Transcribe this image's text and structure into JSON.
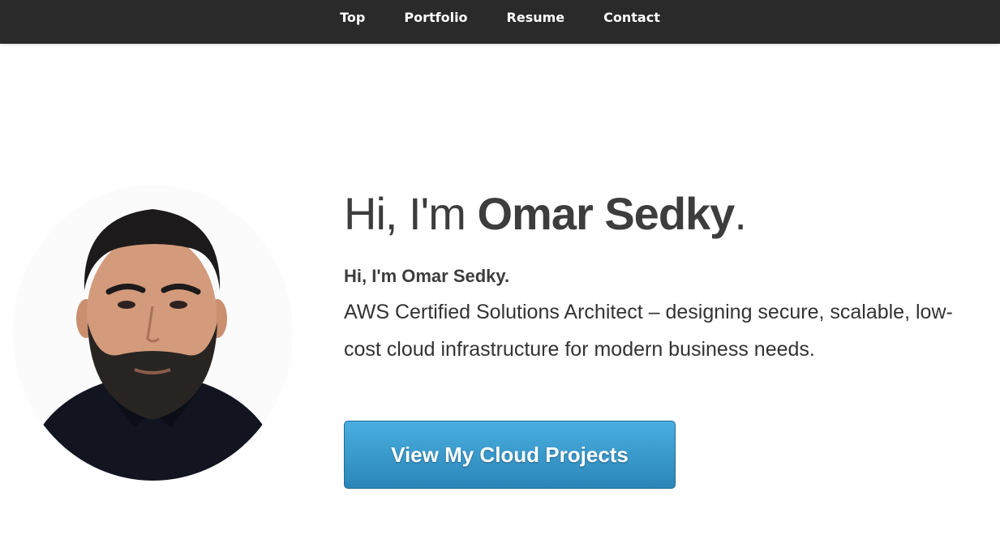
{
  "nav": {
    "items": [
      {
        "label": "Top"
      },
      {
        "label": "Portfolio"
      },
      {
        "label": "Resume"
      },
      {
        "label": "Contact"
      }
    ]
  },
  "hero": {
    "headline_prefix": "Hi, I'm ",
    "headline_name": "Omar Sedky",
    "headline_suffix": ".",
    "sub_title": "Hi, I'm Omar Sedky.",
    "tagline": "AWS Certified Solutions Architect – designing secure, scalable, low-cost cloud infrastructure for modern business needs.",
    "cta_label": "View My Cloud Projects"
  },
  "colors": {
    "nav_bg": "#2a2a2a",
    "cta_top": "#4aaee0",
    "cta_bottom": "#2b86b8",
    "text": "#3d3d3d"
  }
}
